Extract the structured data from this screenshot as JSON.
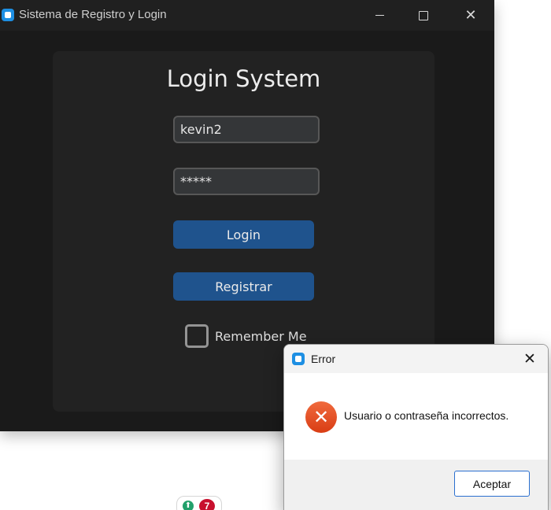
{
  "main_window": {
    "title": "Sistema de Registro y Login",
    "icon": "app-icon",
    "controls": {
      "minimize_icon": "minimize-icon",
      "maximize_icon": "maximize-icon",
      "close_icon": "close-icon"
    }
  },
  "login_form": {
    "heading": "Login System",
    "username_value": "kevin2",
    "password_value": "*****",
    "login_label": "Login",
    "register_label": "Registrar",
    "remember_label": "Remember Me",
    "remember_checked": false
  },
  "error_dialog": {
    "title": "Error",
    "icon": "error-icon",
    "message": "Usuario o contraseña incorrectos.",
    "accept_label": "Aceptar",
    "close_icon": "close-icon"
  },
  "tray": {
    "badge_count": "7",
    "status_icon": "arrow-up-icon"
  },
  "colors": {
    "window_bg": "#1a1a1a",
    "panel_bg": "#222222",
    "button_blue": "#1f538d",
    "error_red": "#d93d14",
    "accent_blue": "#1d8fe3"
  }
}
